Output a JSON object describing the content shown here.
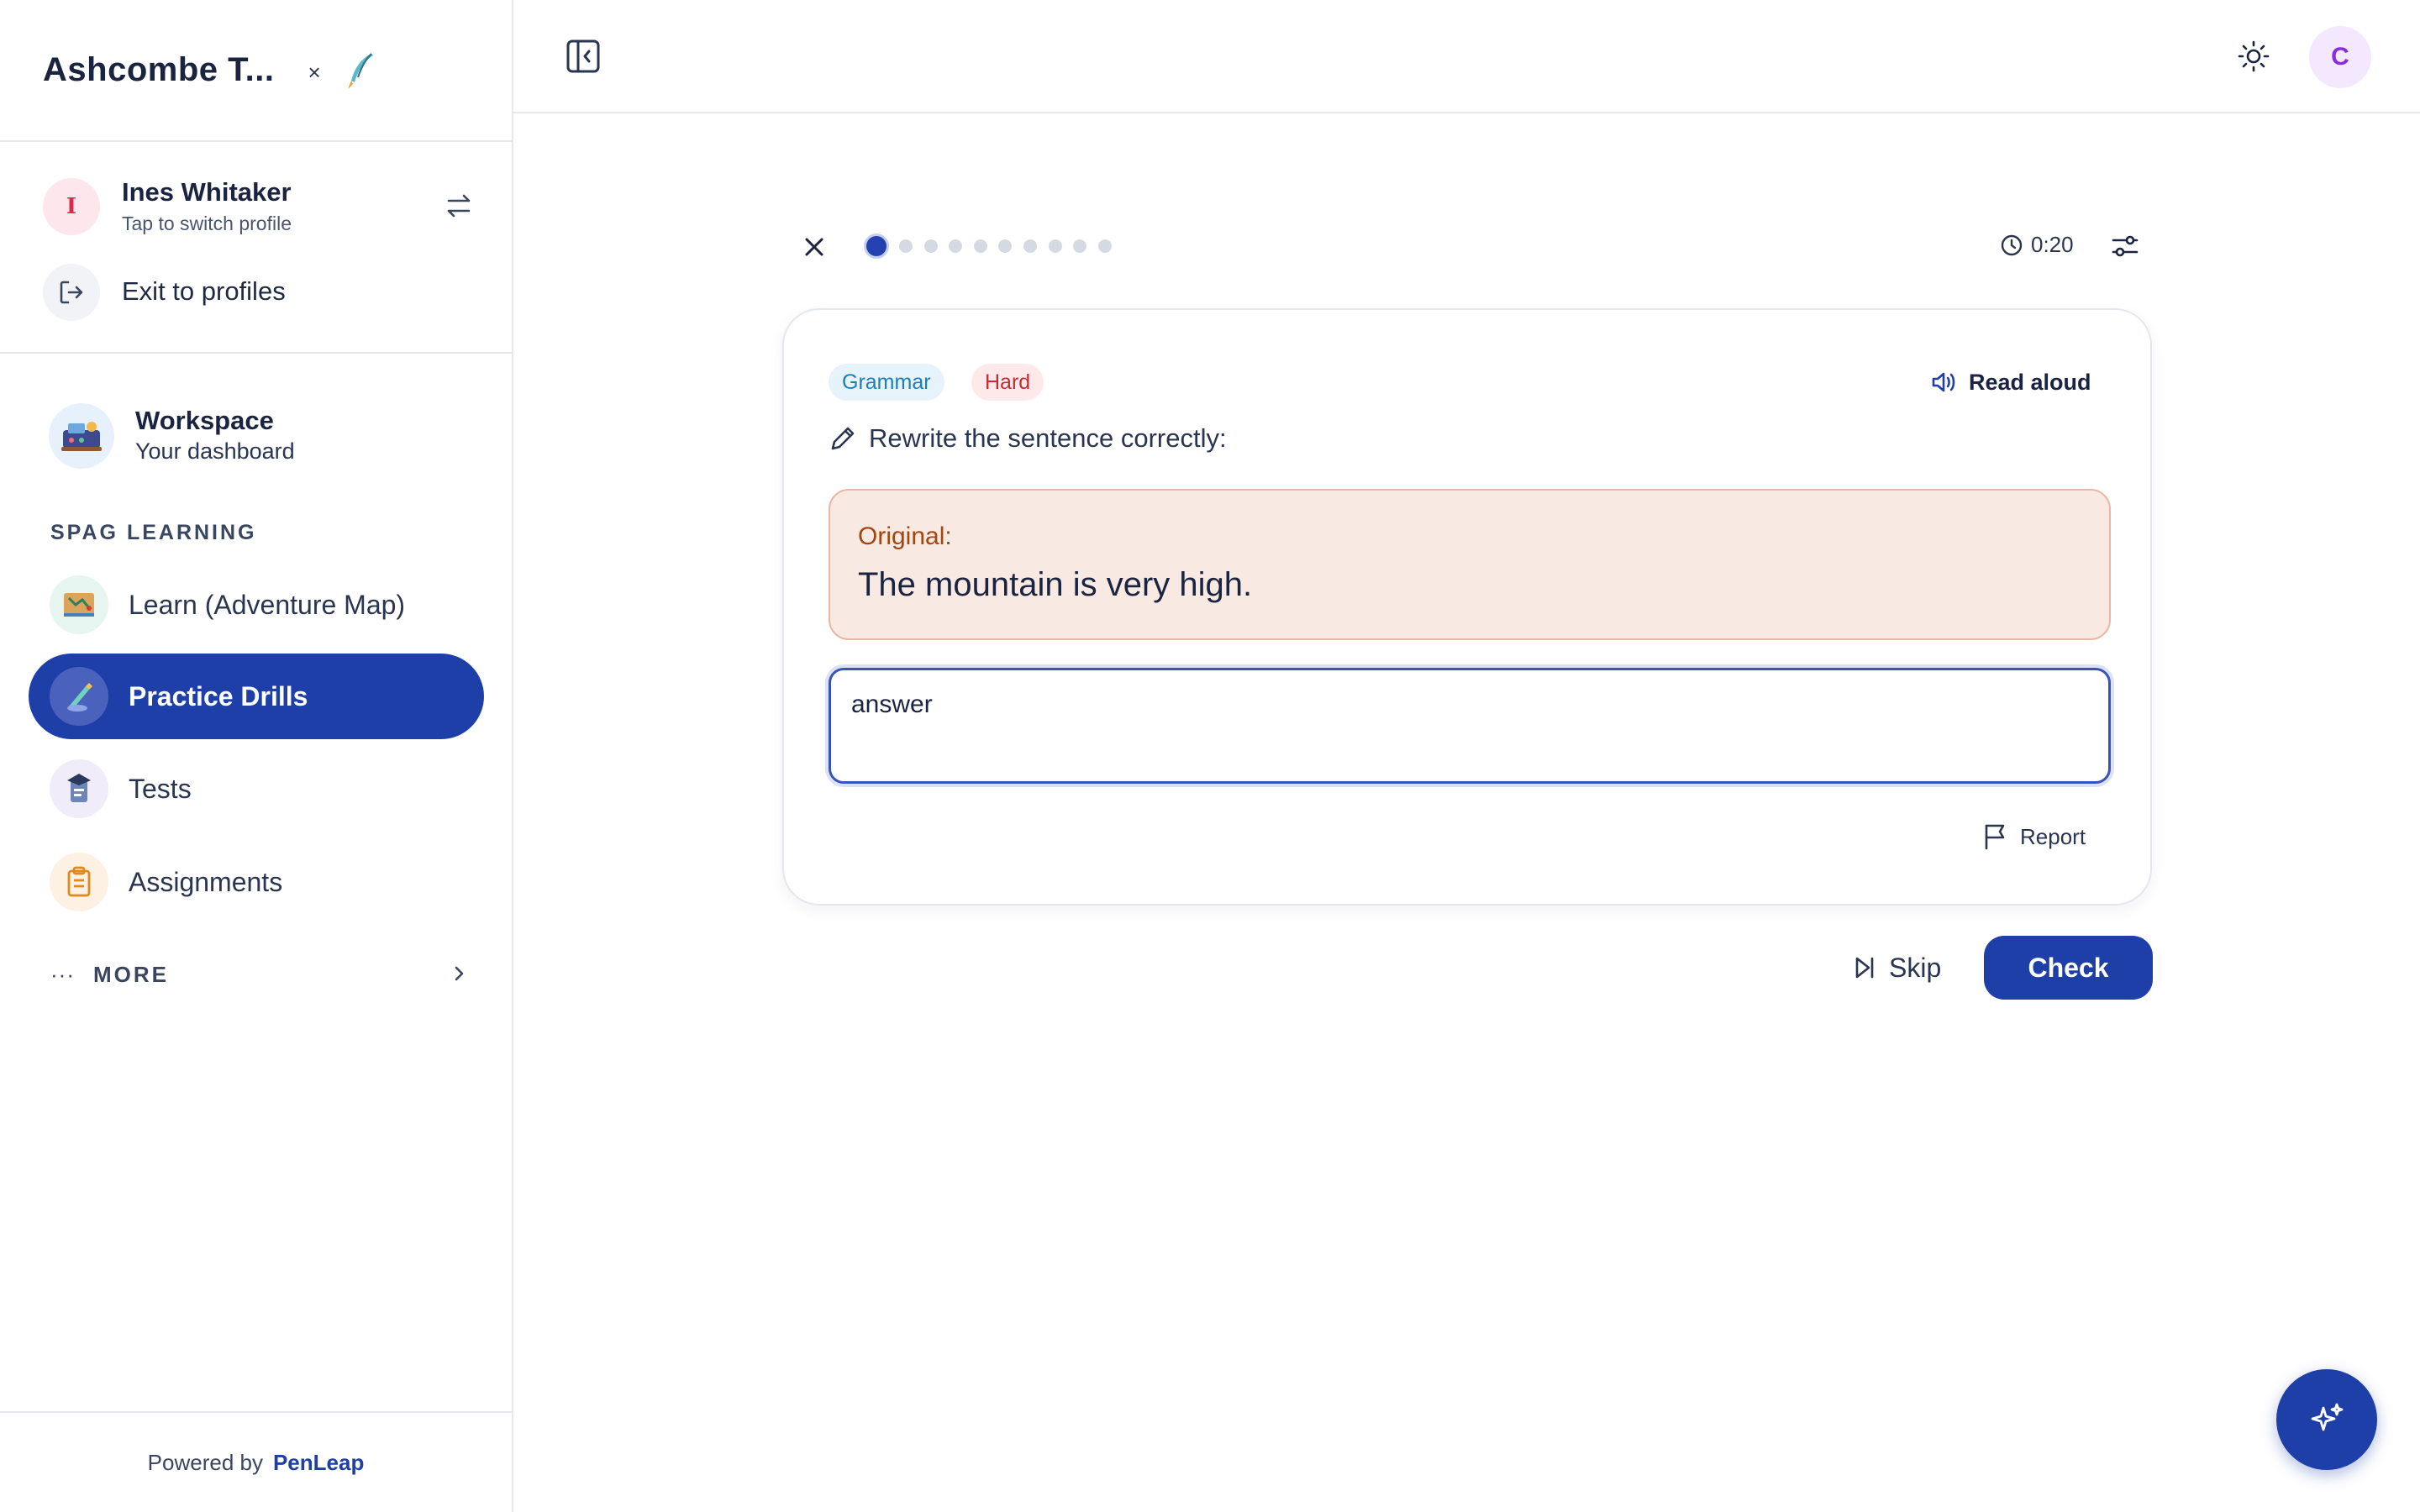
{
  "app": {
    "title": "Ashcombe T...",
    "close_glyph": "×",
    "logo_icon": "quill-logo-icon"
  },
  "profile": {
    "initial": "I",
    "name": "Ines Whitaker",
    "subtitle": "Tap to switch profile",
    "switch_icon": "swap-arrows-icon",
    "exit_label": "Exit to profiles"
  },
  "workspace": {
    "title": "Workspace",
    "subtitle": "Your dashboard"
  },
  "sidebar": {
    "section_label": "SPAG LEARNING",
    "items": [
      {
        "label": "Learn (Adventure Map)",
        "icon": "map-icon",
        "active": false
      },
      {
        "label": "Practice Drills",
        "icon": "drill-icon",
        "active": true
      },
      {
        "label": "Tests",
        "icon": "test-icon",
        "active": false
      },
      {
        "label": "Assignments",
        "icon": "clipboard-icon",
        "active": false
      }
    ],
    "more_label": "MORE",
    "more_dots": "···"
  },
  "footer": {
    "powered_prefix": "Powered by",
    "powered_brand": "PenLeap"
  },
  "topbar": {
    "user_initial": "C"
  },
  "drill": {
    "progress_total": 10,
    "progress_current": 1,
    "timer": "0:20",
    "tags": {
      "category": "Grammar",
      "difficulty": "Hard"
    },
    "read_aloud": "Read aloud",
    "prompt": "Rewrite the sentence correctly:",
    "original_label": "Original:",
    "original_text": "The mountain is very high.",
    "answer_placeholder": "answer",
    "answer_value": "",
    "report_label": "Report",
    "skip_label": "Skip",
    "check_label": "Check"
  },
  "colors": {
    "accent": "#1f3fa8",
    "grammar_badge": "#1b7fb8",
    "hard_badge": "#c42b32",
    "original_bg": "#f9e9e3",
    "original_label": "#a2470e",
    "avatar_user": "#8a2be2"
  }
}
